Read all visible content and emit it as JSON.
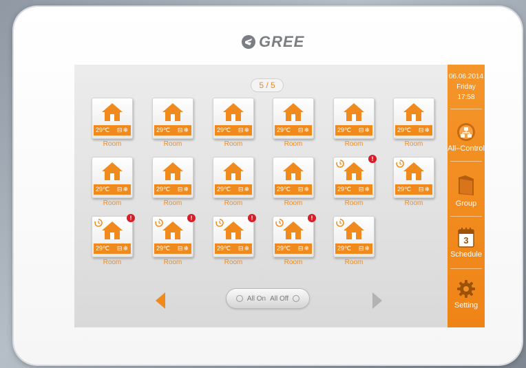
{
  "brand": {
    "name": "GREE"
  },
  "page_indicator": "5 / 5",
  "rooms": [
    {
      "temp": "29℃",
      "label": "Room",
      "timer": false,
      "alert": false
    },
    {
      "temp": "29℃",
      "label": "Room",
      "timer": false,
      "alert": false
    },
    {
      "temp": "29℃",
      "label": "Room",
      "timer": false,
      "alert": false
    },
    {
      "temp": "29℃",
      "label": "Room",
      "timer": false,
      "alert": false
    },
    {
      "temp": "29℃",
      "label": "Room",
      "timer": false,
      "alert": false
    },
    {
      "temp": "29℃",
      "label": "Room",
      "timer": false,
      "alert": false
    },
    {
      "temp": "29℃",
      "label": "Room",
      "timer": false,
      "alert": false
    },
    {
      "temp": "29℃",
      "label": "Room",
      "timer": false,
      "alert": false
    },
    {
      "temp": "29℃",
      "label": "Room",
      "timer": false,
      "alert": false
    },
    {
      "temp": "29℃",
      "label": "Room",
      "timer": false,
      "alert": false
    },
    {
      "temp": "29℃",
      "label": "Room",
      "timer": true,
      "alert": true
    },
    {
      "temp": "29℃",
      "label": "Room",
      "timer": true,
      "alert": false
    },
    {
      "temp": "29℃",
      "label": "Room",
      "timer": true,
      "alert": true
    },
    {
      "temp": "29℃",
      "label": "Room",
      "timer": true,
      "alert": true
    },
    {
      "temp": "29℃",
      "label": "Room",
      "timer": true,
      "alert": true
    },
    {
      "temp": "29℃",
      "label": "Room",
      "timer": true,
      "alert": true
    },
    {
      "temp": "29℃",
      "label": "Room",
      "timer": true,
      "alert": false
    }
  ],
  "controls": {
    "all_on": "All On",
    "all_off": "All Off"
  },
  "sidebar": {
    "date": "06.06.2014",
    "day": "Friday",
    "time": "17:58",
    "items": [
      {
        "label": "All–Control",
        "icon": "all-control-icon"
      },
      {
        "label": "Group",
        "icon": "folder-icon"
      },
      {
        "label": "Schedule",
        "icon": "calendar-icon",
        "calendar_day": "3"
      },
      {
        "label": "Setting",
        "icon": "gear-icon"
      }
    ]
  },
  "colors": {
    "accent": "#f08a1c",
    "alert": "#d61e2b"
  }
}
